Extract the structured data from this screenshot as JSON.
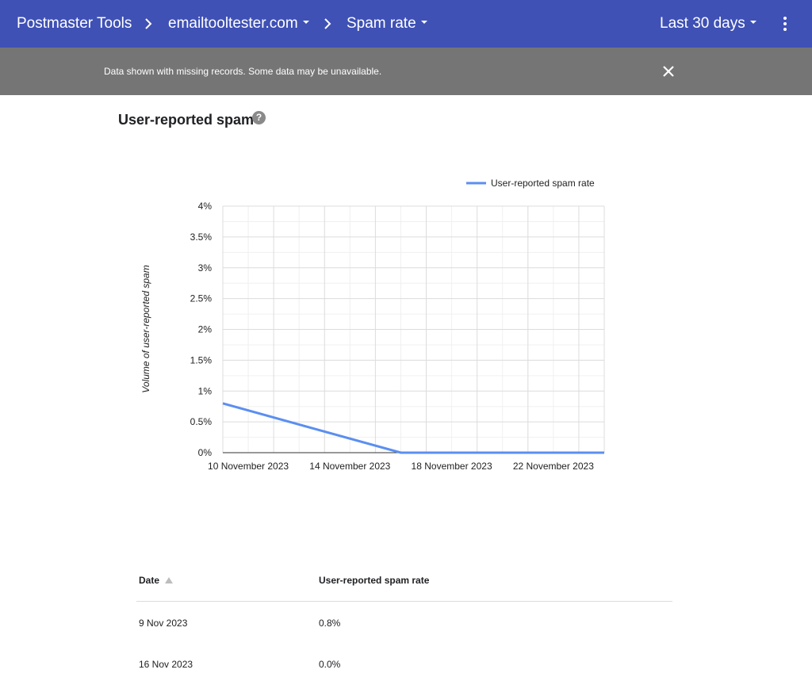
{
  "header": {
    "app_title": "Postmaster Tools",
    "domain": "emailtooltester.com",
    "section": "Spam rate",
    "range": "Last 30 days"
  },
  "banner": {
    "message": "Data shown with missing records. Some data may be unavailable."
  },
  "page": {
    "title": "User-reported spam"
  },
  "chart_data": {
    "type": "line",
    "title": "",
    "ylabel": "Volume of user-reported spam",
    "xlabel": "",
    "ylim": [
      0,
      4
    ],
    "y_ticks": [
      "0%",
      "0.5%",
      "1%",
      "1.5%",
      "2%",
      "2.5%",
      "3%",
      "3.5%",
      "4%"
    ],
    "x_ticks": [
      "10 November 2023",
      "14 November 2023",
      "18 November 2023",
      "22 November 2023"
    ],
    "legend": "top-right",
    "grid": true,
    "series": [
      {
        "name": "User-reported spam rate",
        "color": "#5b8ff0",
        "x": [
          "9 Nov 2023",
          "16 Nov 2023",
          "24 Nov 2023"
        ],
        "y": [
          0.8,
          0.0,
          0.0
        ]
      }
    ]
  },
  "table": {
    "headers": [
      "Date",
      "User-reported spam rate"
    ],
    "rows": [
      [
        "9 Nov 2023",
        "0.8%"
      ],
      [
        "16 Nov 2023",
        "0.0%"
      ]
    ]
  }
}
